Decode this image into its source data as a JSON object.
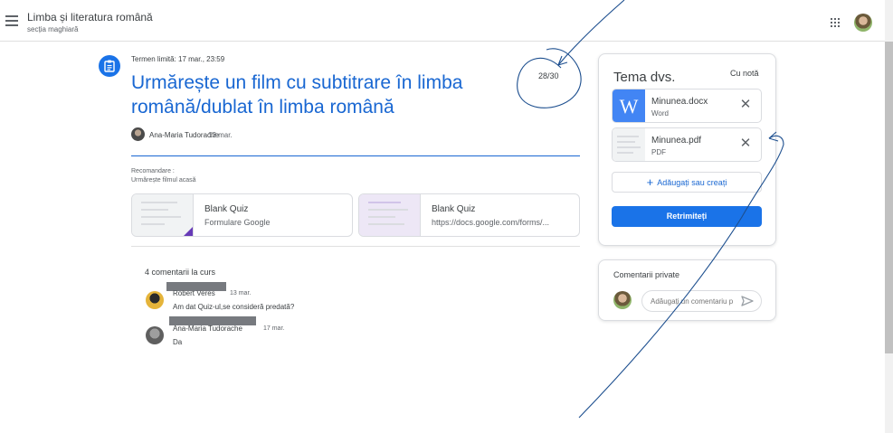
{
  "header": {
    "class_title": "Limba și literatura română",
    "class_subtitle": "secția maghiară"
  },
  "assignment": {
    "due": "Termen limită: 17 mar., 23:59",
    "title": "Urmărește un film cu subtitrare în limba română/dublat în limba română",
    "points": "28/30",
    "author": "Ana-Maria Tudorache",
    "author_date": "13 mar.",
    "recommendation_label": "Recomandare :",
    "recommendation_text": "Urmărește filmul acasă"
  },
  "attachments": [
    {
      "title": "Blank Quiz",
      "subtitle": "Formulare Google"
    },
    {
      "title": "Blank Quiz",
      "subtitle": "https://docs.google.com/forms/..."
    }
  ],
  "comments": {
    "heading": "4 comentarii la curs",
    "items": [
      {
        "name": "Robert Veres",
        "date": "13 mar.",
        "text": "Am dat Quiz-ul,se consideră predată?"
      },
      {
        "name": "Ana-Maria Tudorache",
        "date": "17 mar.",
        "text": "Da"
      }
    ]
  },
  "your_work": {
    "title": "Tema dvs.",
    "status": "Cu notă",
    "files": [
      {
        "name": "Minunea.docx",
        "type": "Word"
      },
      {
        "name": "Minunea.pdf",
        "type": "PDF"
      }
    ],
    "add_label": "Adăugați sau creați",
    "submit_label": "Retrimiteți"
  },
  "private_comments": {
    "title": "Comentarii private",
    "placeholder": "Adăugați un comentariu p"
  },
  "icons": {
    "menu": "hamburger-menu-icon",
    "apps": "apps-grid-icon",
    "assignment": "assignment-icon",
    "remove": "close-icon",
    "add": "plus-icon",
    "send": "send-icon"
  },
  "colors": {
    "accent": "#1a73e8",
    "title_blue": "#1967d2",
    "ink": "#1d4f8f"
  }
}
